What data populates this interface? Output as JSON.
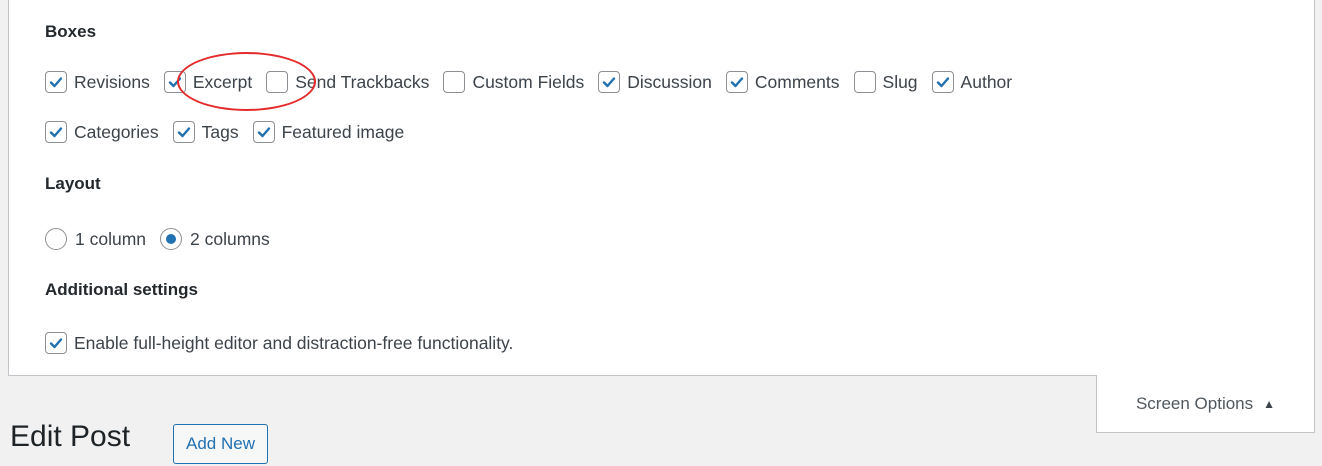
{
  "boxes": {
    "title": "Boxes",
    "row1": [
      {
        "label": "Revisions",
        "checked": true
      },
      {
        "label": "Excerpt",
        "checked": true
      },
      {
        "label": "Send Trackbacks",
        "checked": false
      },
      {
        "label": "Custom Fields",
        "checked": false
      },
      {
        "label": "Discussion",
        "checked": true
      },
      {
        "label": "Comments",
        "checked": true
      },
      {
        "label": "Slug",
        "checked": false
      },
      {
        "label": "Author",
        "checked": true
      }
    ],
    "row2": [
      {
        "label": "Categories",
        "checked": true
      },
      {
        "label": "Tags",
        "checked": true
      },
      {
        "label": "Featured image",
        "checked": true
      }
    ]
  },
  "layout": {
    "title": "Layout",
    "options": [
      {
        "label": "1 column",
        "selected": false
      },
      {
        "label": "2 columns",
        "selected": true
      }
    ]
  },
  "additional": {
    "title": "Additional settings",
    "option": {
      "label": "Enable full-height editor and distraction-free functionality.",
      "checked": true
    }
  },
  "screen_options": {
    "label": "Screen Options",
    "arrow": "▲"
  },
  "page": {
    "title": "Edit Post",
    "add_new_label": "Add New"
  },
  "icons": {
    "check": "checkmark-icon",
    "radio": "radio-dot-icon"
  },
  "colors": {
    "accent": "#2271b1",
    "highlight": "#e32b2b"
  }
}
